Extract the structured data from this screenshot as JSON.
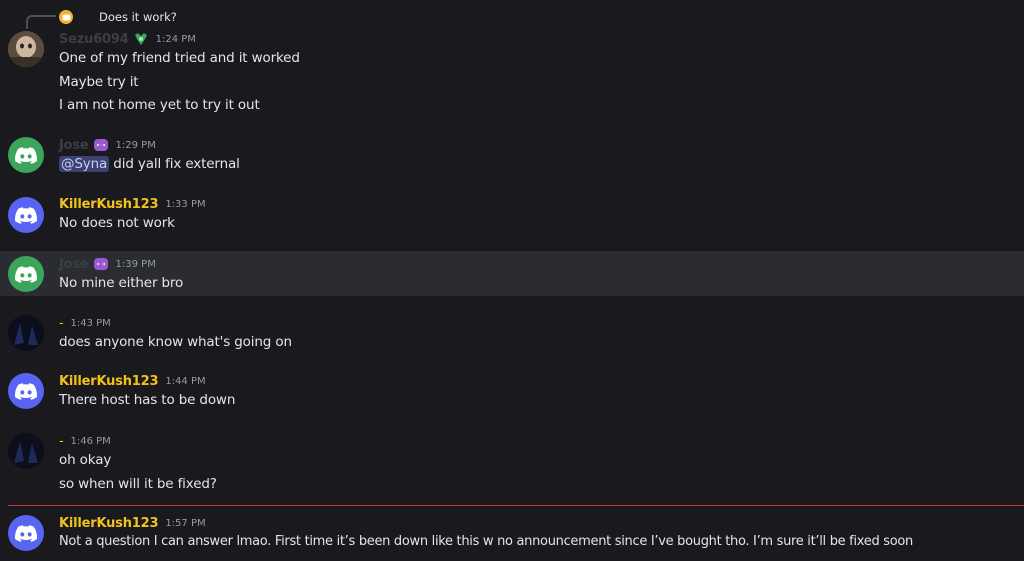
{
  "reply": {
    "text": "Does it work?"
  },
  "colors": {
    "killer": "#f1c21b",
    "jose": "#23a559",
    "dash_name": "#f1c21b",
    "muted_name": "#3b3e45",
    "discord_blurple": "#5865f2",
    "discord_green": "#3ba55c",
    "divider": "#c0373f"
  },
  "messages": [
    {
      "user": "Sezu6094",
      "time": "1:24 PM",
      "avatar": "photo-avatar",
      "badge": "green-shield-icon",
      "lines": [
        "One of my friend tried and it worked",
        "Maybe try it",
        "I am not home yet to try it out"
      ]
    },
    {
      "user": "Jose",
      "time": "1:29 PM",
      "avatar": "discord-green",
      "badge": "purple-mask-icon",
      "mention": "@Syna",
      "lines": [
        "did yall fix external"
      ]
    },
    {
      "user": "KillerKush123",
      "time": "1:33 PM",
      "avatar": "discord-blurple",
      "lines": [
        "No does not work"
      ]
    },
    {
      "user": "Jose",
      "time": "1:39 PM",
      "avatar": "discord-green",
      "badge": "purple-mask-icon",
      "lines": [
        "No mine either bro"
      ]
    },
    {
      "user": "-",
      "time": "1:43 PM",
      "avatar": "dark-avatar",
      "lines": [
        "does anyone know what's going on"
      ]
    },
    {
      "user": "KillerKush123",
      "time": "1:44 PM",
      "avatar": "discord-blurple",
      "lines": [
        "There host has to be down"
      ]
    },
    {
      "user": "-",
      "time": "1:46 PM",
      "avatar": "dark-avatar",
      "lines": [
        "oh okay",
        "so when will it be fixed?"
      ]
    },
    {
      "user": "KillerKush123",
      "time": "1:57 PM",
      "avatar": "discord-blurple",
      "lines": [
        "Not a question I can answer lmao. First time it’s been down like this w no announcement since I’ve bought tho. I’m sure it’ll be fixed soon"
      ]
    }
  ]
}
